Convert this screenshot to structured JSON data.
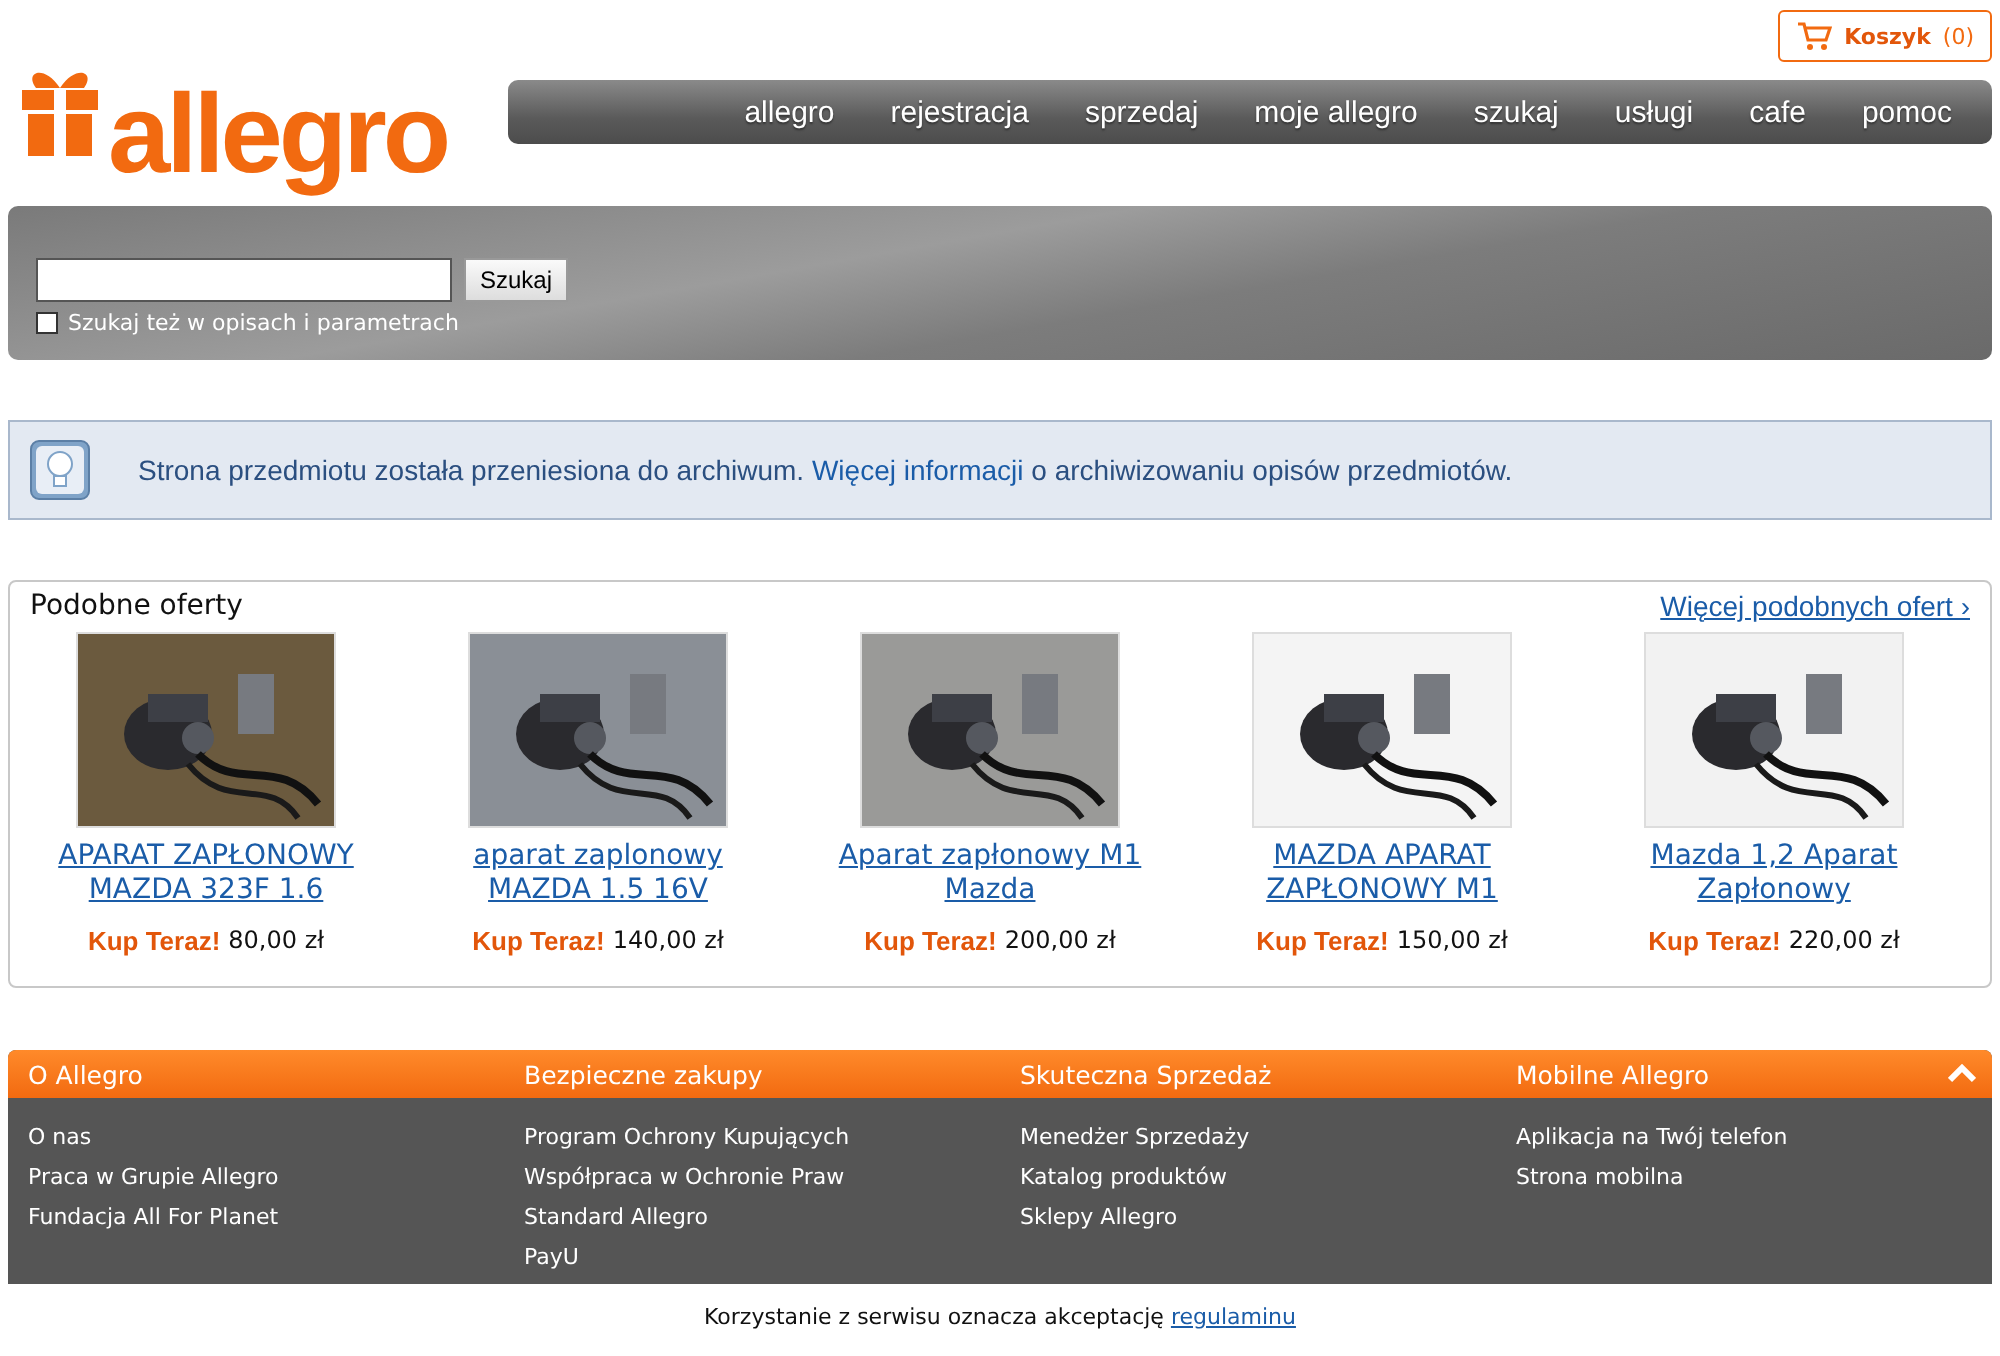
{
  "logo": {
    "text": "allegro"
  },
  "cart": {
    "label": "Koszyk",
    "count": "(0)"
  },
  "nav": [
    {
      "label": "allegro"
    },
    {
      "label": "rejestracja"
    },
    {
      "label": "sprzedaj"
    },
    {
      "label": "moje allegro"
    },
    {
      "label": "szukaj"
    },
    {
      "label": "usługi"
    },
    {
      "label": "cafe"
    },
    {
      "label": "pomoc"
    }
  ],
  "search": {
    "button": "Szukaj",
    "option": {
      "label": "Szukaj też w opisach i parametrach",
      "checked": false
    }
  },
  "notice": {
    "before": "Strona przedmiotu została przeniesiona do archiwum.",
    "link": "Więcej informacji",
    "after": "o archiwizowaniu opisów przedmiotów."
  },
  "similar": {
    "title": "Podobne oferty",
    "more": "Więcej podobnych ofert ›",
    "items": [
      {
        "title": "APARAT ZAPŁONOWY MAZDA 323F 1.6",
        "buy": "Kup Teraz!",
        "price": "80,00 zł"
      },
      {
        "title": "aparat zaplonowy MAZDA 1.5 16V",
        "buy": "Kup Teraz!",
        "price": "140,00 zł"
      },
      {
        "title": "Aparat zapłonowy M1 Mazda",
        "buy": "Kup Teraz!",
        "price": "200,00 zł"
      },
      {
        "title": "MAZDA APARAT ZAPŁONOWY M1",
        "buy": "Kup Teraz!",
        "price": "150,00 zł"
      },
      {
        "title": "Mazda 1,2 Aparat Zapłonowy",
        "buy": "Kup Teraz!",
        "price": "220,00 zł"
      }
    ]
  },
  "footer": {
    "columns": [
      {
        "heading": "O Allegro",
        "links": [
          "O nas",
          "Praca w Grupie Allegro",
          "Fundacja All For Planet"
        ]
      },
      {
        "heading": "Bezpieczne zakupy",
        "links": [
          "Program Ochrony Kupujących",
          "Współpraca w Ochronie Praw",
          "Standard Allegro",
          "PayU"
        ]
      },
      {
        "heading": "Skuteczna Sprzedaż",
        "links": [
          "Menedżer Sprzedaży",
          "Katalog produktów",
          "Sklepy Allegro"
        ]
      },
      {
        "heading": "Mobilne Allegro",
        "links": [
          "Aplikacja na Twój telefon",
          "Strona mobilna"
        ]
      }
    ]
  },
  "terms": {
    "text": "Korzystanie z serwisu oznacza akceptację",
    "link": "regulaminu"
  }
}
